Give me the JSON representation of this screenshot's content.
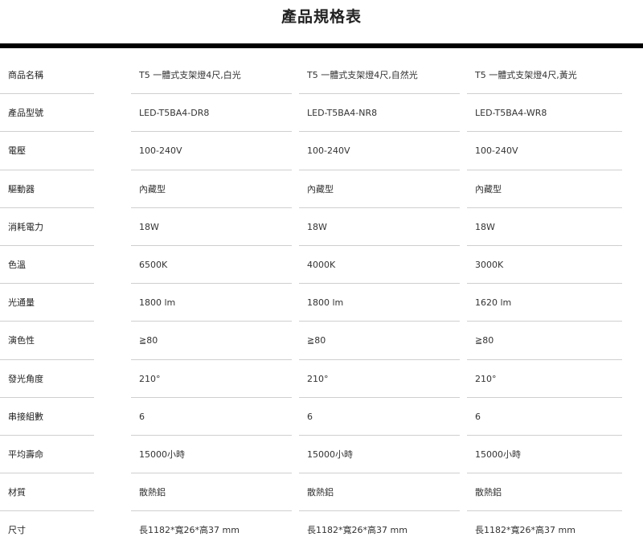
{
  "page": {
    "title": "產品規格表"
  },
  "table": {
    "rows": [
      {
        "label": "商品名稱",
        "values": [
          "T5 一體式支架燈4尺,白光",
          "T5 一體式支架燈4尺,自然光",
          "T5 一體式支架燈4尺,黃光"
        ]
      },
      {
        "label": "產品型號",
        "values": [
          "LED-T5BA4-DR8",
          "LED-T5BA4-NR8",
          "LED-T5BA4-WR8"
        ]
      },
      {
        "label": "電壓",
        "values": [
          "100-240V",
          "100-240V",
          "100-240V"
        ]
      },
      {
        "label": "驅動器",
        "values": [
          "內藏型",
          "內藏型",
          "內藏型"
        ]
      },
      {
        "label": "消耗電力",
        "values": [
          "18W",
          "18W",
          "18W"
        ]
      },
      {
        "label": "色溫",
        "values": [
          "6500K",
          "4000K",
          "3000K"
        ]
      },
      {
        "label": "光通量",
        "values": [
          "1800 lm",
          "1800 lm",
          "1620 lm"
        ]
      },
      {
        "label": "演色性",
        "values": [
          "≧80",
          "≧80",
          "≧80"
        ]
      },
      {
        "label": "發光角度",
        "values": [
          "210°",
          "210°",
          "210°"
        ]
      },
      {
        "label": "串接組數",
        "values": [
          "6",
          "6",
          "6"
        ]
      },
      {
        "label": "平均壽命",
        "values": [
          "15000小時",
          "15000小時",
          "15000小時"
        ]
      },
      {
        "label": "材質",
        "values": [
          "散熱鋁",
          "散熱鋁",
          "散熱鋁"
        ]
      },
      {
        "label": "尺寸",
        "values": [
          "長1182*寬26*高37 mm",
          "長1182*寬26*高37 mm",
          "長1182*寬26*高37 mm"
        ]
      }
    ]
  }
}
